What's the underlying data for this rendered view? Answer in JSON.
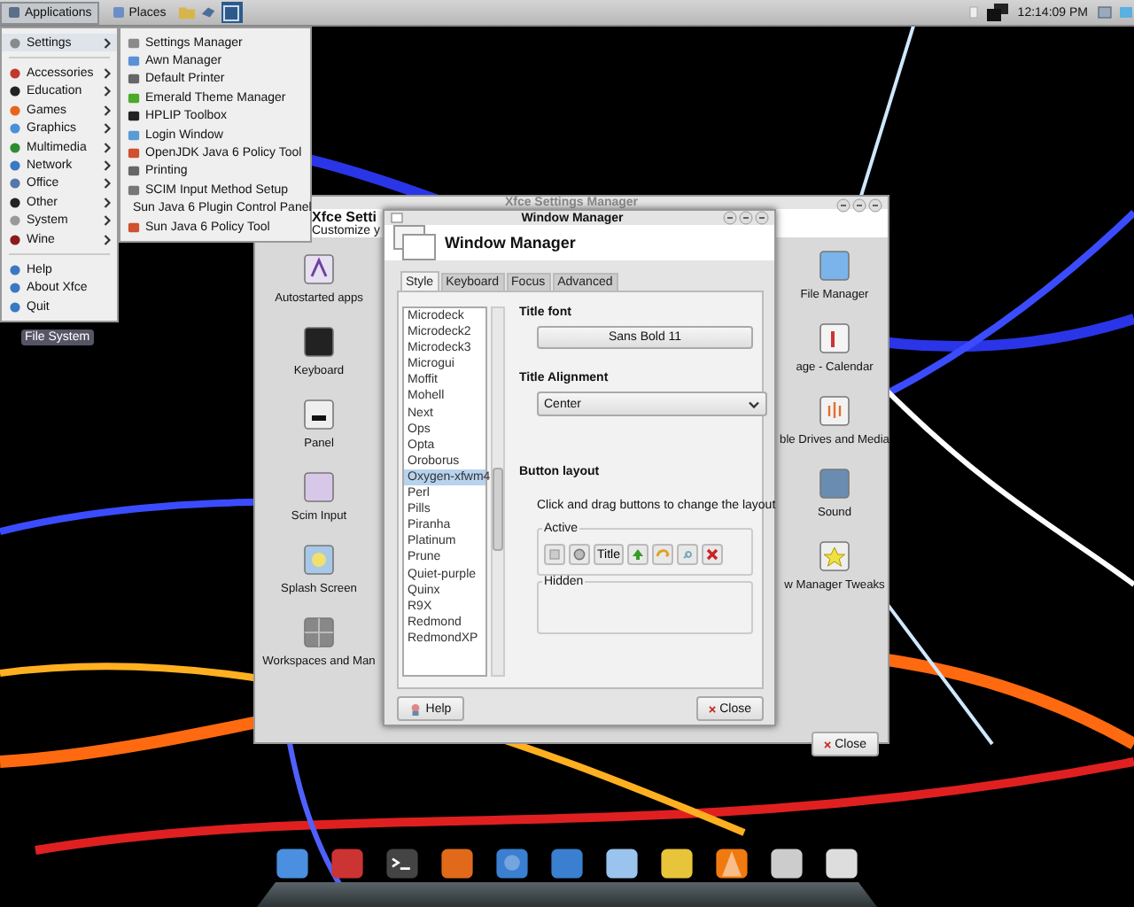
{
  "top_panel": {
    "menu_buttons": [
      {
        "label": "Applications",
        "selected": true
      },
      {
        "label": "Places",
        "selected": false
      }
    ],
    "clock": "12:14:09 PM"
  },
  "applications_menu": {
    "sections": [
      {
        "items": [
          {
            "label": "Settings",
            "kind": "submenu",
            "selected": true
          }
        ]
      },
      {
        "items": [
          {
            "label": "Accessories",
            "kind": "submenu",
            "selected": false
          },
          {
            "label": "Education",
            "kind": "submenu",
            "selected": false
          },
          {
            "label": "Games",
            "kind": "submenu",
            "selected": false
          },
          {
            "label": "Graphics",
            "kind": "submenu",
            "selected": false
          },
          {
            "label": "Multimedia",
            "kind": "submenu",
            "selected": false
          },
          {
            "label": "Network",
            "kind": "submenu",
            "selected": false
          },
          {
            "label": "Office",
            "kind": "submenu",
            "selected": false
          },
          {
            "label": "Other",
            "kind": "submenu",
            "selected": false
          },
          {
            "label": "System",
            "kind": "submenu",
            "selected": false
          },
          {
            "label": "Wine",
            "kind": "submenu",
            "selected": false
          }
        ]
      },
      {
        "items": [
          {
            "label": "Help",
            "kind": "action",
            "selected": false
          },
          {
            "label": "About Xfce",
            "kind": "action",
            "selected": false
          },
          {
            "label": "Quit",
            "kind": "action",
            "selected": false
          }
        ]
      }
    ]
  },
  "settings_submenu": {
    "items": [
      "Settings Manager",
      "Awn Manager",
      "Default Printer",
      "Emerald Theme Manager",
      "HPLIP Toolbox",
      "Login Window",
      "OpenJDK Java 6 Policy Tool",
      "Printing",
      "SCIM Input Method Setup",
      "Sun Java 6 Plugin Control Panel",
      "Sun Java 6 Policy Tool"
    ]
  },
  "desktop_icons": [
    {
      "label": "File System"
    }
  ],
  "settings_window": {
    "title": "Xfce Settings Manager",
    "heading": "Xfce Setti",
    "subheading": "Customize y",
    "left_items": [
      "Autostarted apps",
      "Keyboard",
      "Panel",
      "Scim Input",
      "Splash Screen",
      "Workspaces and Man"
    ],
    "right_items": [
      "File Manager",
      "age - Calendar",
      "ble Drives and Media",
      "Sound",
      "w Manager Tweaks"
    ],
    "close_button": "Close"
  },
  "window_manager_dialog": {
    "title": "Window Manager",
    "heading": "Window Manager",
    "tabs": [
      {
        "label": "Style",
        "selected": true
      },
      {
        "label": "Keyboard",
        "selected": false
      },
      {
        "label": "Focus",
        "selected": false
      },
      {
        "label": "Advanced",
        "selected": false
      }
    ],
    "themes": [
      {
        "label": "Microdeck",
        "selected": false
      },
      {
        "label": "Microdeck2",
        "selected": false
      },
      {
        "label": "Microdeck3",
        "selected": false
      },
      {
        "label": "Microgui",
        "selected": false
      },
      {
        "label": "Moffit",
        "selected": false
      },
      {
        "label": "Mohell",
        "selected": false
      },
      {
        "label": "Next",
        "selected": false
      },
      {
        "label": "Ops",
        "selected": false
      },
      {
        "label": "Opta",
        "selected": false
      },
      {
        "label": "Oroborus",
        "selected": false
      },
      {
        "label": "Oxygen-xfwm4",
        "selected": true
      },
      {
        "label": "Perl",
        "selected": false
      },
      {
        "label": "Pills",
        "selected": false
      },
      {
        "label": "Piranha",
        "selected": false
      },
      {
        "label": "Platinum",
        "selected": false
      },
      {
        "label": "Prune",
        "selected": false
      },
      {
        "label": "Quiet-purple",
        "selected": false
      },
      {
        "label": "Quinx",
        "selected": false
      },
      {
        "label": "R9X",
        "selected": false
      },
      {
        "label": "Redmond",
        "selected": false
      },
      {
        "label": "RedmondXP",
        "selected": false
      }
    ],
    "title_font_label": "Title font",
    "title_font_button": "Sans Bold 11",
    "title_alignment_label": "Title Alignment",
    "title_alignment_value": "Center",
    "button_layout_label": "Button layout",
    "button_layout_hint": "Click and drag buttons to change the layout",
    "active_label": "Active",
    "active_buttons": [
      {
        "kind": "menu"
      },
      {
        "kind": "stick"
      },
      {
        "kind": "title",
        "label": "Title"
      },
      {
        "kind": "shade"
      },
      {
        "kind": "hide"
      },
      {
        "kind": "maximize"
      },
      {
        "kind": "close"
      }
    ],
    "hidden_label": "Hidden",
    "help_button": "Help",
    "close_button": "Close"
  }
}
